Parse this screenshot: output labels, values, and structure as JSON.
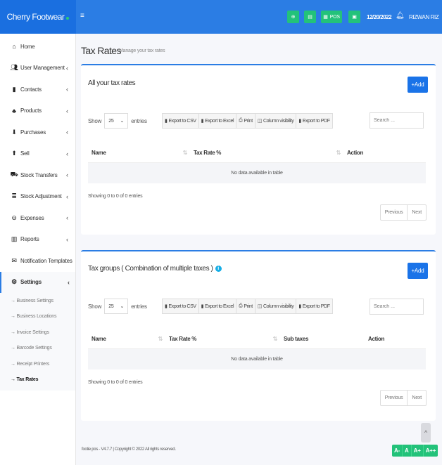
{
  "brand": {
    "name": "Cherry Footwear"
  },
  "topbar": {
    "menu_icon": "≡",
    "buttons": [
      {
        "name": "add-icon"
      },
      {
        "name": "calculator-icon"
      },
      {
        "name": "pos",
        "label": "POS"
      },
      {
        "name": "money-icon"
      }
    ],
    "date": "12/20/2022",
    "user": "RIZWAN RIZ"
  },
  "sidebar": {
    "items": [
      {
        "label": "Home",
        "icon": "home-icon"
      },
      {
        "label": "User Management",
        "icon": "users-icon",
        "chevron": true
      },
      {
        "label": "Contacts",
        "icon": "contacts-icon",
        "chevron": true
      },
      {
        "label": "Products",
        "icon": "products-icon",
        "chevron": true
      },
      {
        "label": "Purchases",
        "icon": "purchases-icon",
        "chevron": true
      },
      {
        "label": "Sell",
        "icon": "sell-icon",
        "chevron": true
      },
      {
        "label": "Stock Transfers",
        "icon": "truck-icon",
        "chevron": true
      },
      {
        "label": "Stock Adjustment",
        "icon": "database-icon",
        "chevron": true
      },
      {
        "label": "Expenses",
        "icon": "expenses-icon",
        "chevron": true
      },
      {
        "label": "Reports",
        "icon": "chart-icon",
        "chevron": true
      },
      {
        "label": "Notification Templates",
        "icon": "envelope-icon"
      },
      {
        "label": "Settings",
        "icon": "gear-icon",
        "chevron": true,
        "active": true
      }
    ],
    "sub_items": [
      {
        "label": "→ Business Settings"
      },
      {
        "label": "→ Business Locations"
      },
      {
        "label": "→ Invoice Settings"
      },
      {
        "label": "→ Barcode Settings"
      },
      {
        "label": "→ Receipt Printers"
      },
      {
        "label": "→ Tax Rates",
        "active": true
      }
    ]
  },
  "page": {
    "title": "Tax Rates",
    "subtitle": "Manage your tax rates"
  },
  "common": {
    "show": "Show",
    "entries": "entries",
    "page_length": "25",
    "export_csv": "Export to CSV",
    "export_excel": "Export to Excel",
    "print": "Print",
    "column_visibility": "Column visibility",
    "export_pdf": "Export to PDF",
    "search_placeholder": "Search ...",
    "add": "+Add",
    "empty": "No data available in table",
    "showing": "Showing 0 to 0 of 0 entries",
    "previous": "Previous",
    "next": "Next"
  },
  "tax_rates": {
    "title": "All your tax rates",
    "columns": [
      "Name",
      "Tax Rate %",
      "Action"
    ]
  },
  "tax_groups": {
    "title": "Tax groups ( Combination of multiple taxes )",
    "columns": [
      "Name",
      "Tax Rate %",
      "Sub taxes",
      "Action"
    ]
  },
  "footer": {
    "text": "footie pos - V4.7.7 | Copyright © 2022 All rights reserved.",
    "font_controls": [
      "A-",
      "A",
      "A+",
      "A++"
    ],
    "scroll_top": "^"
  }
}
